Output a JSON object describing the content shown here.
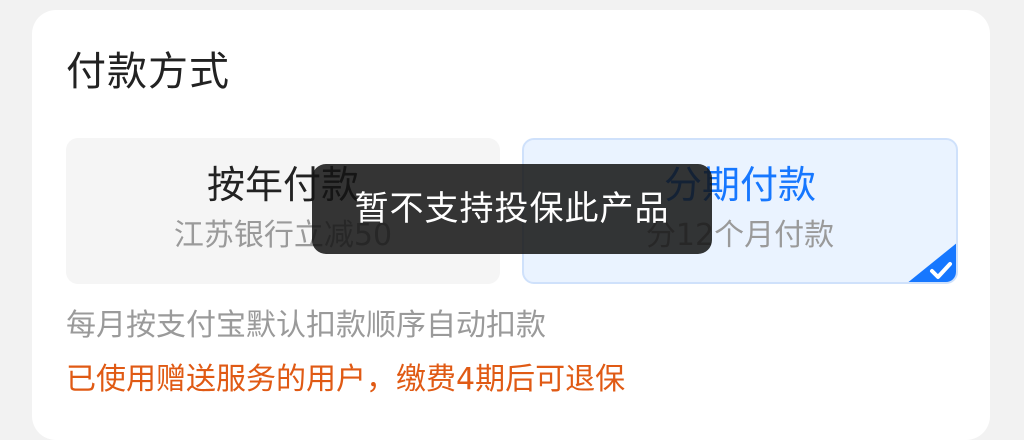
{
  "payment": {
    "title": "付款方式",
    "options": [
      {
        "name": "按年付款",
        "sub": "江苏银行立减50",
        "selected": false
      },
      {
        "name": "分期付款",
        "sub": "分12个月付款",
        "selected": true
      }
    ],
    "note": "每月按支付宝默认扣款顺序自动扣款",
    "warning": "已使用赠送服务的用户，缴费4期后可退保"
  },
  "toast": {
    "message": "暂不支持投保此产品"
  },
  "colors": {
    "accent": "#1677ff",
    "selected_bg": "#eaf3ff",
    "warning": "#e05a14",
    "muted_text": "#9a9a9a",
    "toast_bg": "#141414"
  },
  "icons": {
    "selected_mark": "check-icon"
  }
}
